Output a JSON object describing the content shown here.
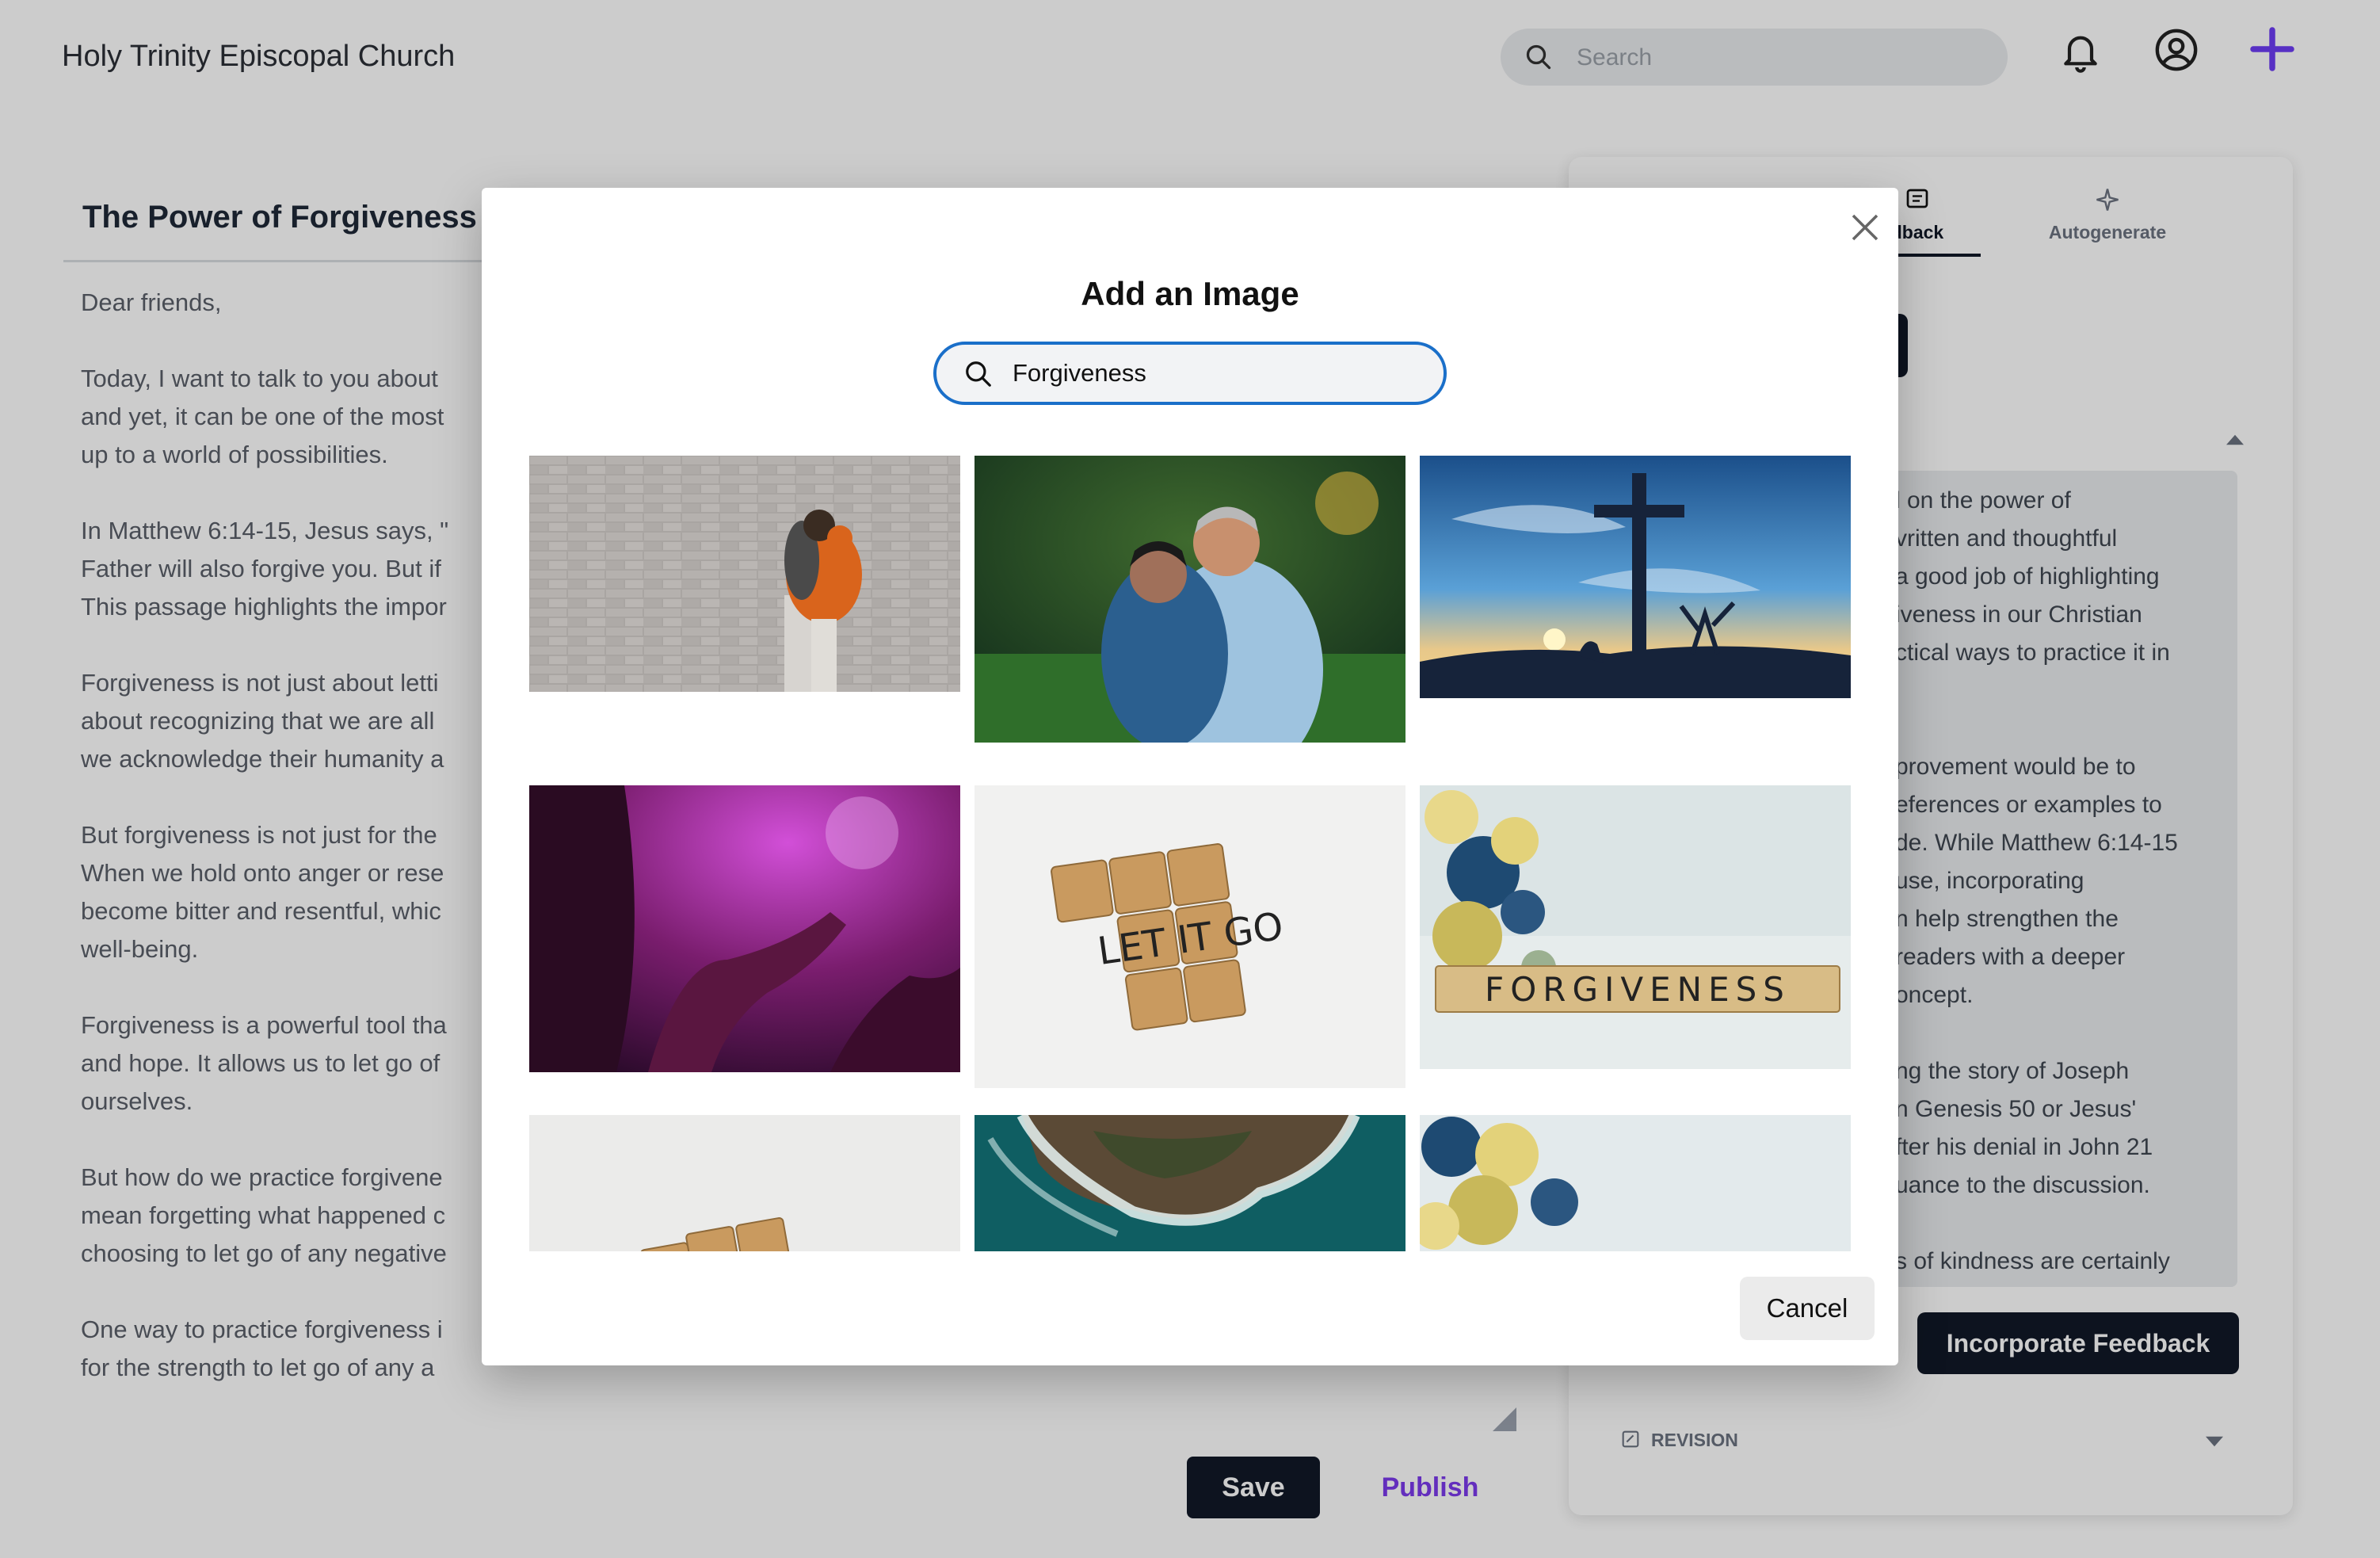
{
  "header": {
    "church_name": "Holy Trinity Episcopal Church",
    "search_placeholder": "Search"
  },
  "editor": {
    "title": "The Power of Forgiveness",
    "paragraphs": [
      "Dear friends,",
      "Today, I want to talk to you about\nand yet, it can be one of the most\nup to a world of possibilities.",
      "In Matthew 6:14-15, Jesus says, \"\nFather will also forgive you. But if\nThis passage highlights the impor",
      "Forgiveness is not just about letti\nabout recognizing that we are all\nwe acknowledge their humanity a",
      "But forgiveness is not just for the\nWhen we hold onto anger or rese\nbecome bitter and resentful, whic\nwell-being.",
      "Forgiveness is a powerful tool tha\nand hope. It allows us to let go of\nourselves.",
      "But how do we practice forgivene\nmean forgetting what happened c\nchoosing to let go of any negative",
      "One way to practice forgiveness i\nfor the strength to let go of any a"
    ],
    "save_label": "Save",
    "publish_label": "Publish"
  },
  "side_panel": {
    "tabs": [
      {
        "label": "dback"
      },
      {
        "label": "Autogenerate"
      }
    ],
    "feedback_text": "l on the power of\nvritten and thoughtful\n a good job of highlighting\niveness in our Christian\nctical ways to practice it in\n\n\nprovement would be to\neferences or examples to\nde. While Matthew 6:14-15\nuse, incorporating\nn help strengthen the\n readers with a deeper\noncept.\n\nng the story of Joseph\nn Genesis 50 or Jesus'\nfter his denial in John 21\nuance to the discussion.\n\ns of kindness are certainly",
    "incorporate_label": "Incorporate Feedback",
    "revision_label": "REVISION"
  },
  "modal": {
    "title": "Add an Image",
    "search_value": "Forgiveness",
    "cancel_label": "Cancel",
    "images": [
      {
        "name": "couple-hugging-brick-wall",
        "text": ""
      },
      {
        "name": "man-woman-embrace-garden",
        "text": ""
      },
      {
        "name": "cross-silhouette-sunset",
        "text": ""
      },
      {
        "name": "hands-raised-purple-light",
        "text": ""
      },
      {
        "name": "let-it-go-tiles",
        "text": "LET IT GO"
      },
      {
        "name": "forgiveness-tiles-flowers",
        "text": "FORGIVENESS"
      },
      {
        "name": "tiles-white-surface",
        "text": ""
      },
      {
        "name": "aerial-coast-waves",
        "text": ""
      },
      {
        "name": "flowers-white-background",
        "text": ""
      }
    ]
  },
  "colors": {
    "accent_purple": "#7c3aed",
    "search_focus_blue": "#1a6fc9",
    "dark_button": "#111827"
  }
}
